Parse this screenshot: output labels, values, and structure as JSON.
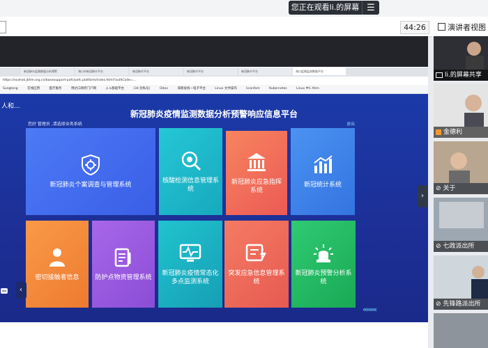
{
  "share_banner": {
    "text": "您正在观看li.的屏幕",
    "menu_icon": "menu-icon"
  },
  "meeting": {
    "timer": "44:26",
    "speaker_view_label": "演讲者视图"
  },
  "browser": {
    "tabs": [
      "新冠肺炎疫情数据分析预警",
      "海口市新冠肺炎平台",
      "新冠肺炎平台",
      "新冠肺炎平台",
      "新冠肺炎平台",
      "海口疫情监测数据平台"
    ],
    "url": "https://xxxhxk.jkhm.org.cn/baseoupport-pafc/pafc.platform/index.html?authCode=...",
    "bookmarks": [
      "Sungtong",
      "在线应用",
      "医疗服务",
      "博达口政府门户网",
      "入·k基础平台",
      "(34 封私信)",
      "Odoo",
      "海南省统一电子平台",
      "Linux 文件操作",
      "kconfom",
      "Kubernetes",
      "Linux 中1 Ahm"
    ]
  },
  "app": {
    "logo": "人和...",
    "title": "新冠肺炎疫情监测数据分析预警响应信息平台",
    "greeting": "您好 管理员 ,请选择业务系统",
    "logout": "退出",
    "tiles_row1": [
      {
        "label": "新冠肺炎个案调查与管理系统",
        "icon": "virus-shield-icon",
        "color": "#3f69f0"
      },
      {
        "label": "核酸检测信息管理系统",
        "icon": "virus-magnifier-icon",
        "color": "#19b7c8"
      },
      {
        "label": "新冠肺炎应急指挥系统",
        "icon": "government-building-icon",
        "color": "#f06a5a"
      },
      {
        "label": "新冠统计系统",
        "icon": "bar-chart-icon",
        "color": "#3d86ee"
      }
    ],
    "tiles_row2": [
      {
        "label": "密切接触者信息",
        "icon": "contacts-icon",
        "color": "#f28b3c"
      },
      {
        "label": "防护点物资管理系统",
        "icon": "supplies-icon",
        "color": "#9a58dd"
      },
      {
        "label": "新冠肺炎疫情常态化多点监测系统",
        "icon": "monitor-pulse-icon",
        "color": "#18b6c2"
      },
      {
        "label": "突发应急信息管理系统",
        "icon": "emergency-info-icon",
        "color": "#ee6d5c"
      },
      {
        "label": "新冠肺炎预警分析系统",
        "icon": "alarm-light-icon",
        "color": "#20b968"
      }
    ]
  },
  "participants": [
    {
      "name": "li.的屏幕共享",
      "icon": "screen-share-icon"
    },
    {
      "name": "金德利",
      "icon": "user-icon"
    },
    {
      "name": "关于",
      "icon": "mic-off-icon"
    },
    {
      "name": "七政派出所",
      "icon": "mic-off-icon"
    },
    {
      "name": "",
      "icon": "mic-off-icon"
    },
    {
      "name": "先锋路派出所",
      "icon": "mic-off-icon"
    }
  ]
}
